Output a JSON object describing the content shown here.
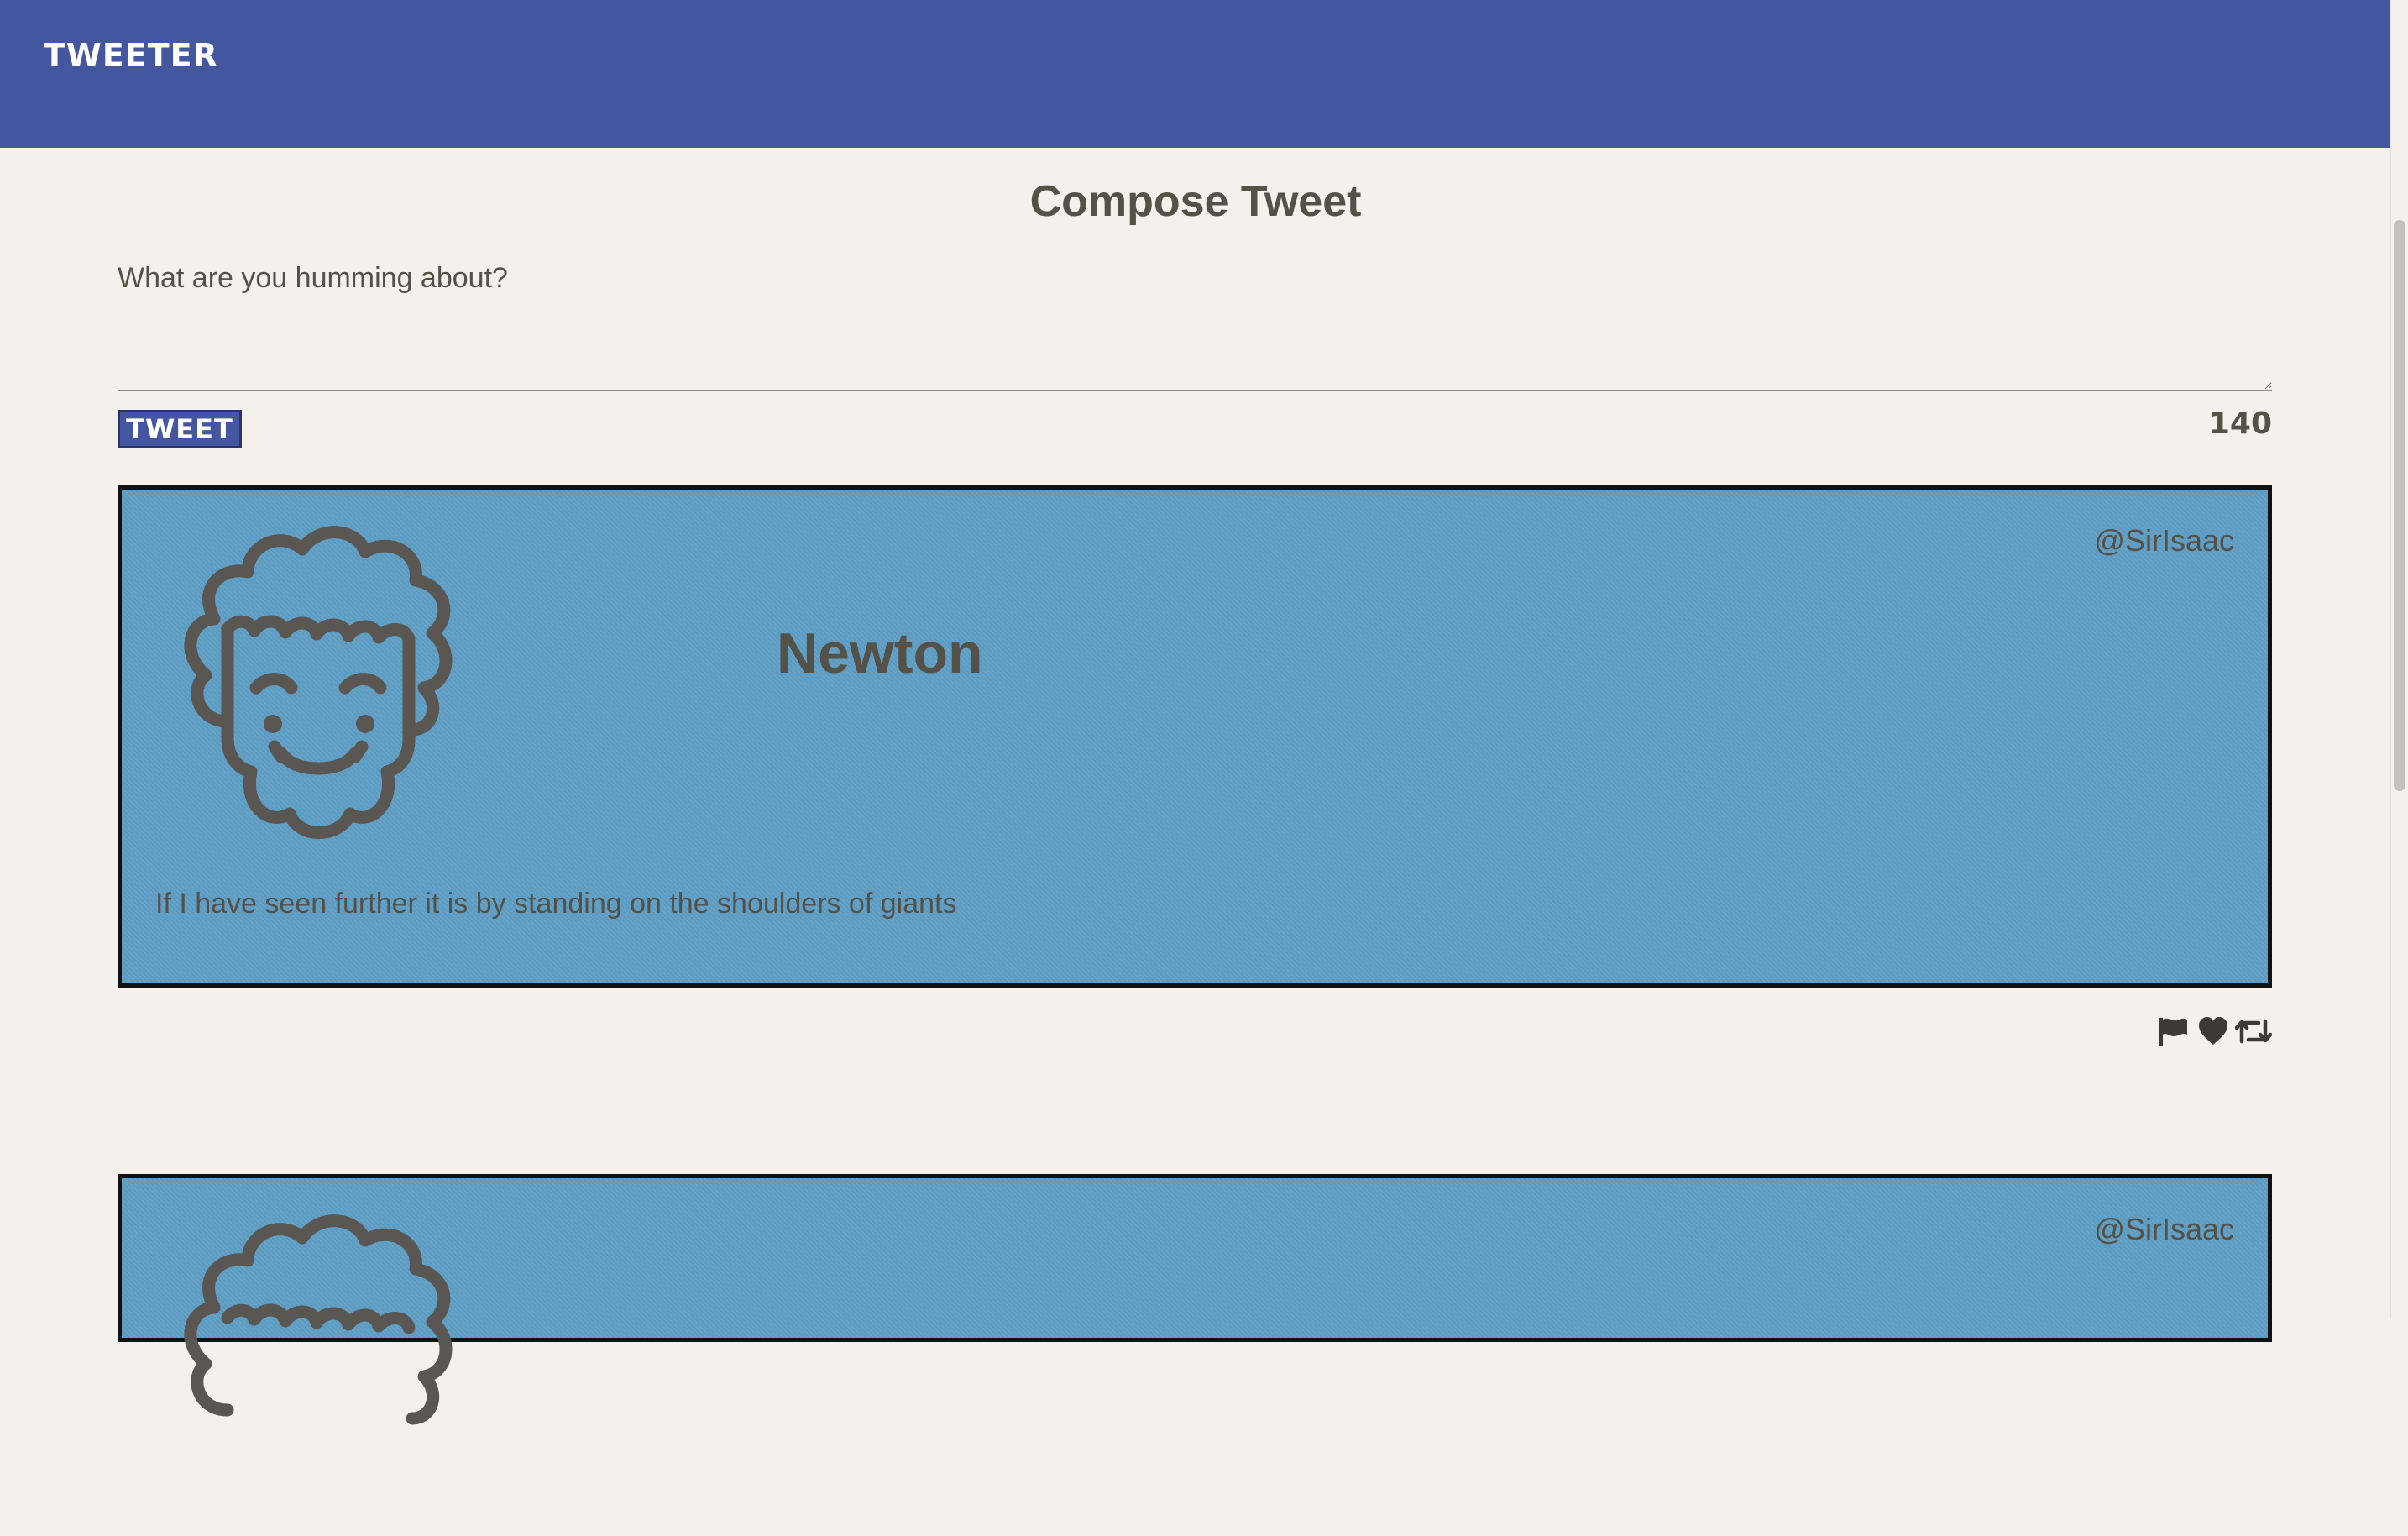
{
  "nav": {
    "brand": "TWEETER"
  },
  "compose": {
    "title": "Compose Tweet",
    "placeholder": "What are you humming about?",
    "button_label": "TWEET",
    "counter": "140"
  },
  "tweets": [
    {
      "name": "Newton",
      "handle": "@SirIsaac",
      "content": "If I have seen further it is by standing on the shoulders of giants",
      "avatar_icon": "curly-hair-face-icon",
      "actions": [
        "flag-icon",
        "heart-icon",
        "retweet-icon"
      ]
    },
    {
      "handle": "@SirIsaac",
      "avatar_icon": "curly-hair-face-icon"
    }
  ],
  "colors": {
    "nav_bg": "#4456a0",
    "page_bg": "#f4f1ec",
    "card_bg": "#5f9fc5",
    "text": "#545149"
  }
}
